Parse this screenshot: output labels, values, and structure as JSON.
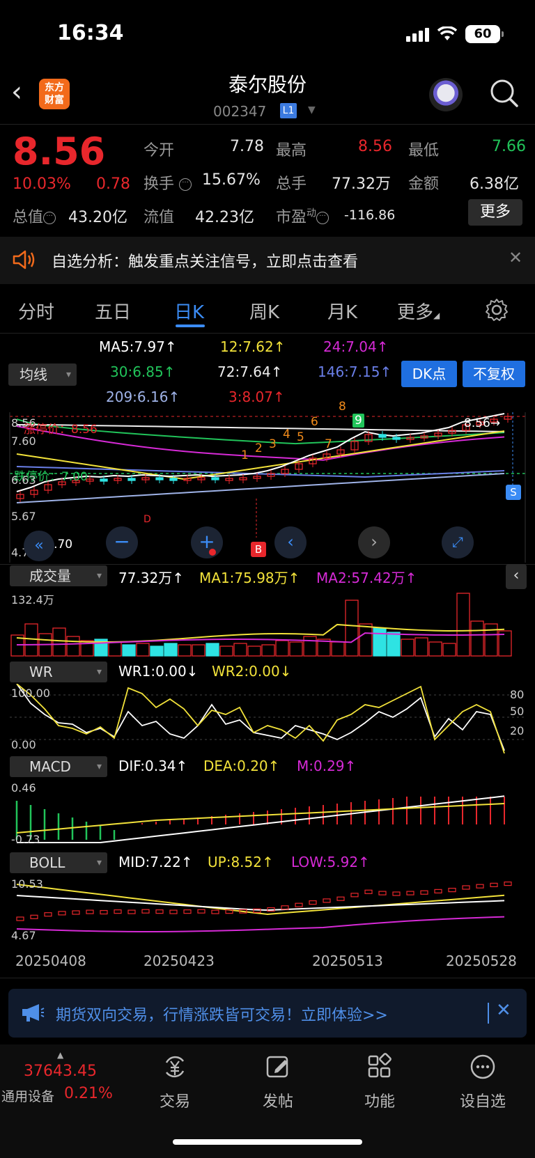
{
  "status": {
    "time": "16:34",
    "battery": "60"
  },
  "header": {
    "logo": "东方财富",
    "name": "泰尔股份",
    "code": "002347",
    "level": "L1"
  },
  "quote": {
    "price": "8.56",
    "pct": "10.03%",
    "change": "0.78",
    "open_label": "今开",
    "open": "7.78",
    "high_label": "最高",
    "high": "8.56",
    "low_label": "最低",
    "low": "7.66",
    "turnover_label": "换手",
    "turnover": "15.67%",
    "volume_label": "总手",
    "volume": "77.32万",
    "amount_label": "金额",
    "amount": "6.38亿",
    "total_value_label": "总值",
    "total_value": "43.20亿",
    "float_value_label": "流值",
    "float_value": "42.23亿",
    "pe_label": "市盈",
    "pe_sup": "动",
    "pe": "-116.86",
    "more": "更多"
  },
  "notice": {
    "text": "自选分析：触发重点关注信号，立即点击查看"
  },
  "tabs": [
    "分时",
    "五日",
    "日K",
    "周K",
    "月K",
    "更多"
  ],
  "ma": {
    "button": "均线",
    "ma5": "MA5:7.97↑",
    "ma12": "12:7.62↑",
    "ma24": "24:7.04↑",
    "ma30": "30:6.85↑",
    "ma72": "72:7.64↑",
    "ma146": "146:7.15↑",
    "ma209": "209:6.16↑",
    "ma3": "3:8.07↑",
    "dk": "DK点",
    "fq": "不复权"
  },
  "kline": {
    "y_top": "8.56",
    "limit_up_label": "涨停价：8.56",
    "y_760": "7.60",
    "limit_down_label": "跌停价：7.00",
    "y_663": "6.63",
    "y_567": "5.67",
    "y_470": "4.70",
    "min_marker": "4.70",
    "max_marker": "8.56→",
    "b_mark": "B",
    "s_mark": "S",
    "d_mark": "D",
    "seq_marks": [
      "1",
      "2",
      "3",
      "4",
      "5",
      "6",
      "7",
      "8",
      "9"
    ]
  },
  "volume": {
    "button": "成交量",
    "vol": "77.32万↑",
    "ma1": "MA1:75.98万↑",
    "ma2": "MA2:57.42万↑",
    "y_top": "132.4万"
  },
  "wr": {
    "button": "WR",
    "wr1": "WR1:0.00↓",
    "wr2": "WR2:0.00↓",
    "y_top": "100.00",
    "y_bottom": "0.00",
    "r80": "80",
    "r50": "50",
    "r20": "20"
  },
  "macd": {
    "button": "MACD",
    "dif": "DIF:0.34↑",
    "dea": "DEA:0.20↑",
    "m": "M:0.29↑",
    "y_top": "0.46",
    "y_bottom": "-0.73"
  },
  "boll": {
    "button": "BOLL",
    "mid": "MID:7.22↑",
    "up": "UP:8.52↑",
    "low": "LOW:5.92↑",
    "y_top": "10.53",
    "y_bottom": "4.67"
  },
  "dates": [
    "20250408",
    "20250423",
    "20250513",
    "20250528"
  ],
  "banner": {
    "text": "期货双向交易，行情涨跌皆可交易！立即体验>>"
  },
  "bottom": {
    "index_value": "37643.45",
    "index_name": "通用设备",
    "index_pct": "0.21%",
    "nav": [
      "交易",
      "发帖",
      "功能",
      "设自选"
    ]
  },
  "colors": {
    "up": "#e8272c",
    "down": "#21c45a",
    "accent": "#1f6fe0",
    "cyan": "#2ee3e3"
  }
}
